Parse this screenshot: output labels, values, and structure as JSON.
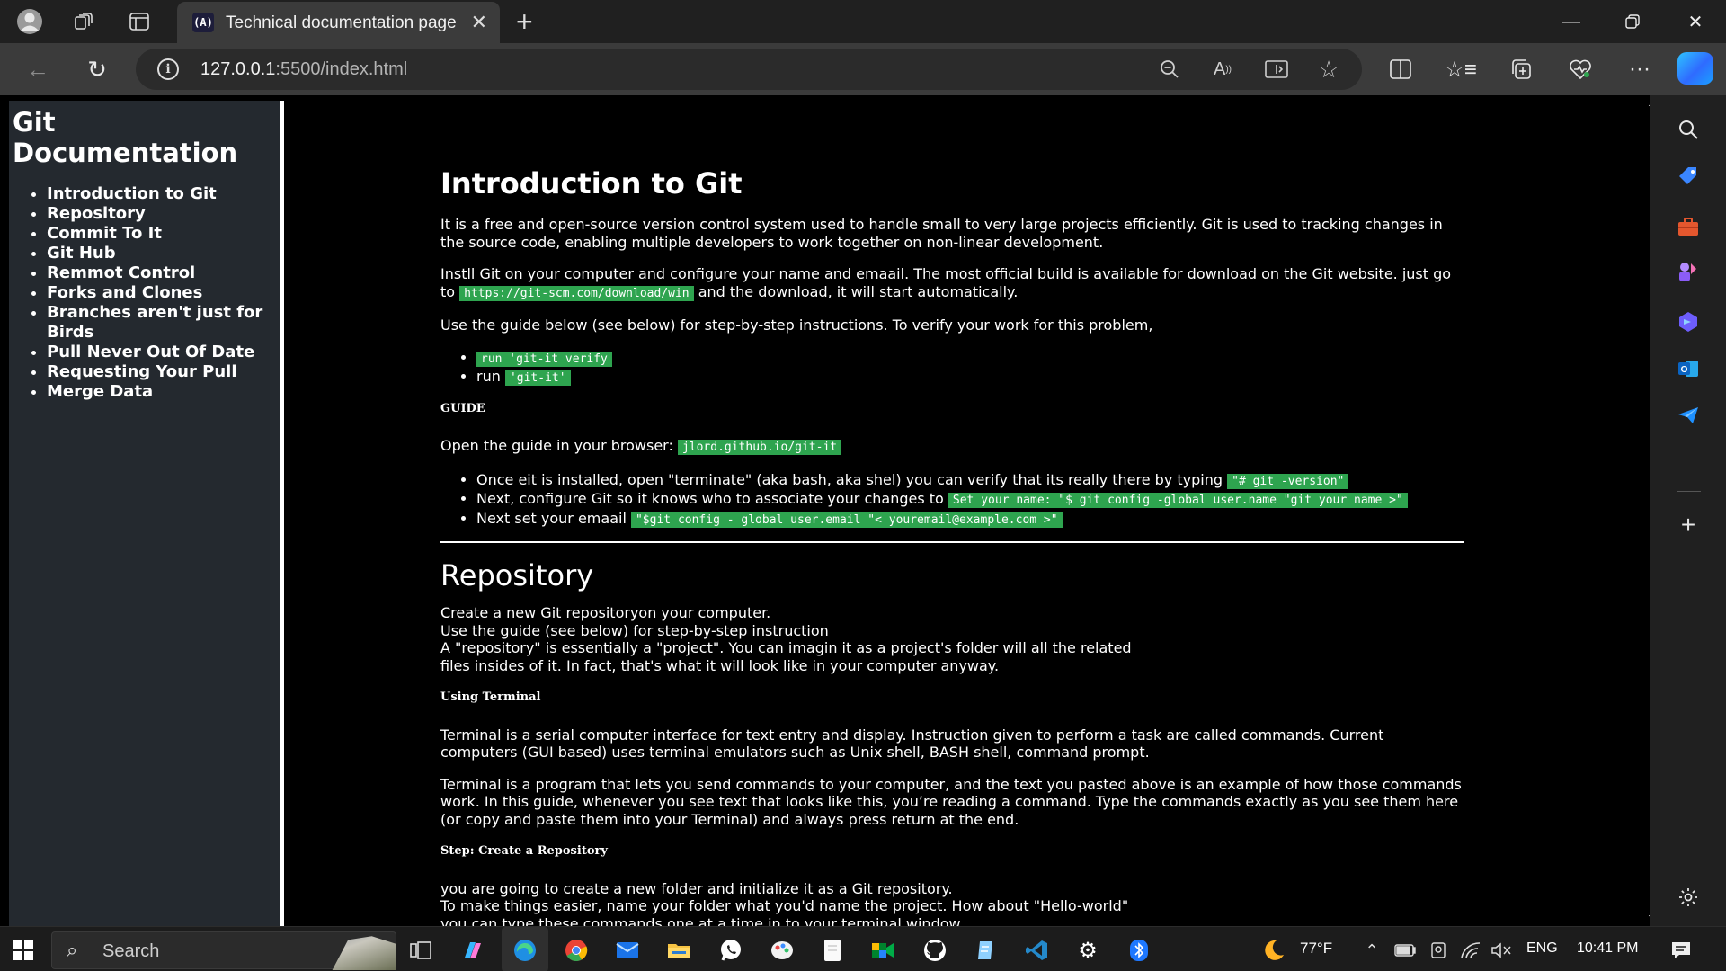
{
  "browser": {
    "tab_title": "Technical documentation page",
    "tab_favicon": "(A)",
    "url_host": "127.0.0.1",
    "url_path": ":5500/index.html"
  },
  "sidebar": {
    "title": "Git Documentation",
    "items": [
      {
        "label": "Introduction to Git"
      },
      {
        "label": "Repository"
      },
      {
        "label": "Commit To It"
      },
      {
        "label": "Git Hub"
      },
      {
        "label": "Remmot Control"
      },
      {
        "label": "Forks and Clones"
      },
      {
        "label": "Branches aren't just for Birds"
      },
      {
        "label": "Pull Never Out Of Date"
      },
      {
        "label": "Requesting Your Pull"
      },
      {
        "label": "Merge Data"
      }
    ]
  },
  "intro": {
    "heading": "Introduction to Git",
    "p1": "It is a free and open-source version control system used to handle small to very large projects efficiently. Git is used to tracking changes in the source code, enabling multiple developers to work together on non-linear development.",
    "p2_before": "Instll Git on your computer and configure your name and emaail. The most official build is available for download on the Git website. just go to ",
    "p2_code": "https://git-scm.com/download/win",
    "p2_after": " and the download, it will start automatically.",
    "p3": "Use the guide below (see below) for step-by-step instructions. To verify your work for this problem,",
    "verify_item1_code": "run 'git-it verify",
    "verify_item2_text": "run ",
    "verify_item2_code": "'git-it'",
    "guide_heading": "GUIDE",
    "guide_text": "Open the guide in your browser: ",
    "guide_code": "jlord.github.io/git-it",
    "steps": [
      {
        "text": "Once eit is installed, open \"terminate\" (aka bash, aka shel) you can verify that its really there by typing ",
        "code": "\"# git -version\""
      },
      {
        "text": "Next, configure Git so it knows who to associate your changes to ",
        "code": "Set your name: \"$ git config -global user.name \"git your name >\""
      },
      {
        "text": "Next set your emaail ",
        "code": "\"$git config - global user.email \"< youremail@example.com >\""
      }
    ]
  },
  "repository": {
    "heading": "Repository",
    "line1": "Create a new Git repositoryon your computer.",
    "line2": "Use the guide (see below) for step-by-step instruction",
    "line3": "A \"repository\" is essentially a \"project\". You can imagin it as a project's folder will all the related",
    "line4": "files insides of it. In fact, that's what it will look like in your computer anyway.",
    "terminal_heading": "Using Terminal",
    "terminal_p1": "Terminal is a serial computer interface for text entry and display. Instruction given to perform a task are called commands. Current computers (GUI based) uses terminal emulators such as Unix shell, BASH shell, command prompt.",
    "terminal_p2": "Terminal is a program that lets you send commands to your computer, and the text you pasted above is an example of how those commands work. In this guide, whenever you see text that looks like this, you’re reading a command. Type the commands exactly as you see them here (or copy and paste them into your Terminal) and always press return at the end.",
    "step_heading": "Step: Create a Repository",
    "step_line1": "you are going to create a new folder and initialize it as a Git repository.",
    "step_line2": "To make things easier, name your folder what you'd name the project. How about \"Hello-world\"",
    "step_line3": "you can type these commands one at a time in to your terminal window."
  },
  "taskbar": {
    "search_placeholder": "Search",
    "weather": "77°F",
    "language": "ENG",
    "time": "10:41 PM"
  },
  "colors": {
    "code_bg": "#2ea44f",
    "sidebar_bg": "#24292f",
    "page_bg": "#000000"
  }
}
